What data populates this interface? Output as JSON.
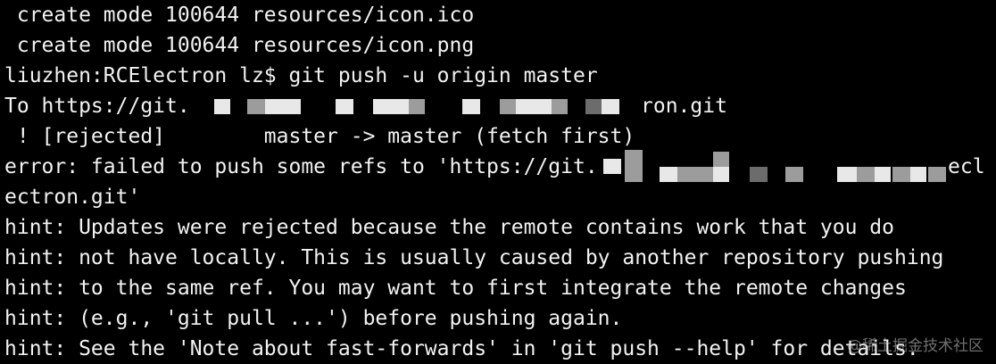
{
  "terminal": {
    "lines": [
      " create mode 100644 resources/icon.ico",
      " create mode 100644 resources/icon.png",
      "liuzhen:RCElectron lz$ git push -u origin master",
      "To https://git.",
      " ! [rejected]        master -> master (fetch first)",
      "error: failed to push some refs to 'https://git.",
      "ectron.git'",
      "hint: Updates were rejected because the remote contains work that you do",
      "hint: not have locally. This is usually caused by another repository pushing",
      "hint: to the same ref. You may want to first integrate the remote changes",
      "hint: (e.g., 'git pull ...') before pushing again.",
      "hint: See the 'Note about fast-forwards' in 'git push --help' for details."
    ],
    "redacted_tails": {
      "line4": "ron.git",
      "line6": "ecl"
    }
  },
  "watermark": "@稀土掘金技术社区",
  "colors": {
    "background": "#000000",
    "text": "#f2f2f2"
  }
}
